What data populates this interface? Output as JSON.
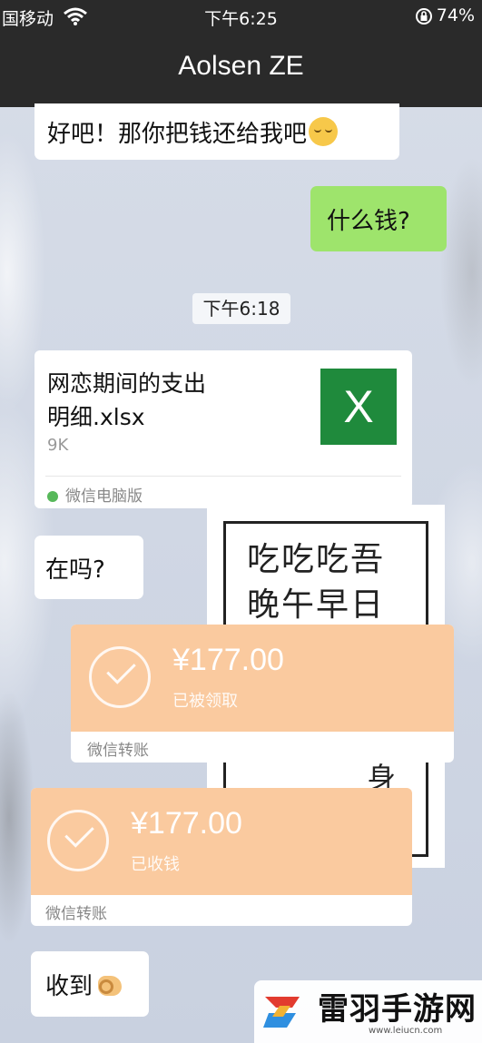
{
  "status_bar": {
    "carrier": "国移动",
    "time": "下午6:25",
    "battery": "74%"
  },
  "header": {
    "title": "Aolsen ZE"
  },
  "icons": {
    "wifi": "wifi-icon",
    "rotation_lock": "rotation-lock-icon",
    "excel": "excel-file-icon",
    "wechat": "wechat-logo-icon",
    "check": "check-circle-icon",
    "emoji_pensive": "pensive-face-emoji",
    "emoji_ok": "ok-hand-emoji"
  },
  "colors": {
    "title_bar": "#2a2a2a",
    "green_bubble": "#9ee46c",
    "transfer_orange": "#fac79a",
    "excel_green": "#1f8a3c"
  },
  "messages": {
    "msg1": "好吧！那你把钱还给我吧",
    "msg2": "什么钱?",
    "timestamp": "下午6:18",
    "file": {
      "name_line1": "网恋期间的支出",
      "name_line2": "明细.xlsx",
      "size": "9K",
      "icon_letter": "X",
      "source": "微信电脑版"
    },
    "msg3": "在吗?",
    "transfer1": {
      "amount": "¥177.00",
      "status": "已被领取",
      "footer": "微信转账"
    },
    "transfer2": {
      "amount": "¥177.00",
      "status": "已收钱",
      "footer": "微信转账"
    },
    "msg4": "收到"
  },
  "photo": {
    "line1": "吃吃吃吾",
    "line2": "晚午早日",
    "char": "身"
  },
  "watermark": {
    "name": "雷羽手游网",
    "url": "www.leiucn.com"
  }
}
